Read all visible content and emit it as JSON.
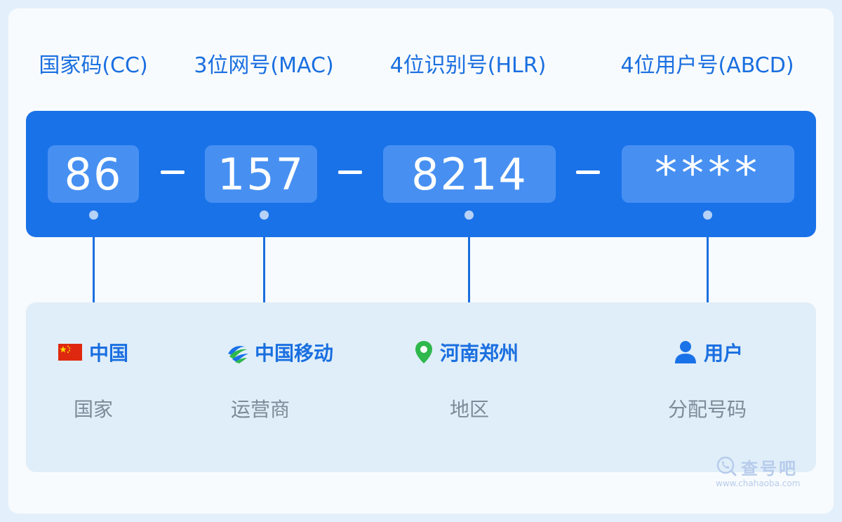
{
  "labels": {
    "cc": "国家码(CC)",
    "mac": "3位网号(MAC)",
    "hlr": "4位识别号(HLR)",
    "abcd": "4位用户号(ABCD)"
  },
  "number": {
    "cc": "86",
    "mac": "157",
    "hlr": "8214",
    "abcd": "****"
  },
  "details": {
    "country": {
      "value": "中国",
      "category": "国家",
      "icon": "china-flag-icon"
    },
    "carrier": {
      "value": "中国移动",
      "category": "运营商",
      "icon": "china-mobile-logo-icon"
    },
    "region": {
      "value": "河南郑州",
      "category": "地区",
      "icon": "location-pin-icon"
    },
    "user": {
      "value": "用户",
      "category": "分配号码",
      "icon": "user-icon"
    }
  },
  "brand": {
    "name": "查号吧",
    "url": "www.chahaoba.com"
  },
  "colors": {
    "accent": "#1a72e8",
    "segment": "#4790f2",
    "panel": "#e0eef9",
    "pin": "#2fb84c",
    "flag": "#de2910"
  }
}
